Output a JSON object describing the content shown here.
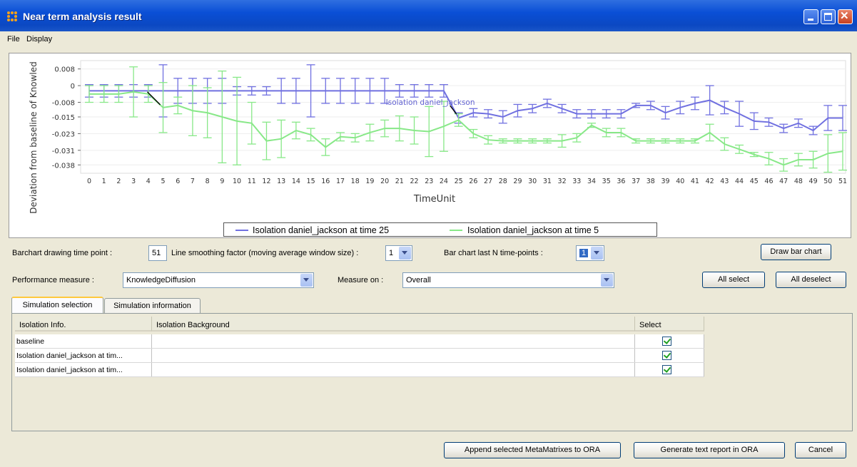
{
  "window": {
    "title": "Near term analysis result"
  },
  "menu": {
    "items": [
      "File",
      "Display"
    ]
  },
  "chart_data": {
    "type": "line",
    "xlabel": "TimeUnit",
    "ylabel": "Deviation from baseline of Knowled",
    "x": [
      0,
      1,
      2,
      3,
      4,
      5,
      6,
      7,
      8,
      9,
      10,
      11,
      12,
      13,
      14,
      15,
      16,
      17,
      18,
      19,
      20,
      21,
      22,
      23,
      24,
      25,
      26,
      27,
      28,
      29,
      30,
      31,
      32,
      33,
      34,
      35,
      36,
      37,
      38,
      39,
      40,
      41,
      42,
      43,
      44,
      45,
      46,
      47,
      48,
      49,
      50,
      51
    ],
    "x_tick_labels": [
      "0",
      "1",
      "2",
      "3",
      "4",
      "5",
      "6",
      "7",
      "8",
      "9",
      "10",
      "11",
      "12",
      "13",
      "14",
      "15",
      "16",
      "17",
      "18",
      "19",
      "20",
      "21",
      "22",
      "23",
      "24",
      "25",
      "26",
      "27",
      "28",
      "29",
      "30",
      "31",
      "32",
      "33",
      "34",
      "35",
      "36",
      "37",
      "38",
      "39",
      "40",
      "41",
      "42",
      "43",
      "44",
      "45",
      "46",
      "47",
      "48",
      "49",
      "50",
      "51"
    ],
    "y_tick_labels": [
      "0.008",
      "0",
      "-0.008",
      "-0.015",
      "-0.023",
      "-0.031",
      "-0.038"
    ],
    "ylim": [
      -0.042,
      0.012
    ],
    "grid": true,
    "legend_position": "bottom-center",
    "annotations": [
      {
        "text": "Isolation daniel_jackson",
        "x": 25,
        "y": -0.015
      }
    ],
    "series": [
      {
        "name": "Isolation daniel_jackson at time 25",
        "color": "#7070E0",
        "values": [
          -0.0025,
          -0.0025,
          -0.0025,
          -0.0025,
          -0.0025,
          -0.0025,
          -0.0025,
          -0.0025,
          -0.0025,
          -0.0025,
          -0.0025,
          -0.0025,
          -0.0025,
          -0.0025,
          -0.0025,
          -0.0025,
          -0.0025,
          -0.0025,
          -0.0025,
          -0.0025,
          -0.0025,
          -0.0025,
          -0.0025,
          -0.0025,
          -0.0025,
          -0.0155,
          -0.013,
          -0.0135,
          -0.015,
          -0.012,
          -0.011,
          -0.0085,
          -0.011,
          -0.0135,
          -0.0135,
          -0.0135,
          -0.0135,
          -0.0095,
          -0.0095,
          -0.013,
          -0.0105,
          -0.0085,
          -0.007,
          -0.0105,
          -0.0135,
          -0.017,
          -0.0175,
          -0.0205,
          -0.018,
          -0.0215,
          -0.0155,
          -0.0155
        ],
        "err": [
          0.003,
          0.003,
          0.003,
          0.003,
          0.003,
          0.0125,
          0.006,
          0.006,
          0.006,
          0.006,
          0.002,
          0.002,
          0.002,
          0.006,
          0.006,
          0.0125,
          0.006,
          0.006,
          0.006,
          0.006,
          0.006,
          0.003,
          0.003,
          0.003,
          0.003,
          0.0025,
          0.002,
          0.002,
          0.003,
          0.003,
          0.002,
          0.002,
          0.002,
          0.002,
          0.002,
          0.002,
          0.002,
          0.001,
          0.002,
          0.003,
          0.003,
          0.003,
          0.007,
          0.003,
          0.006,
          0.004,
          0.002,
          0.002,
          0.002,
          0.002,
          0.006,
          0.006
        ]
      },
      {
        "name": "Isolation daniel_jackson at time 5",
        "color": "#88E888",
        "values": [
          -0.004,
          -0.004,
          -0.004,
          -0.003,
          -0.004,
          -0.0105,
          -0.0095,
          -0.012,
          -0.013,
          -0.015,
          -0.017,
          -0.018,
          -0.0265,
          -0.0255,
          -0.0215,
          -0.0235,
          -0.0295,
          -0.0245,
          -0.025,
          -0.0225,
          -0.0205,
          -0.0205,
          -0.0215,
          -0.022,
          -0.0195,
          -0.0165,
          -0.023,
          -0.026,
          -0.0265,
          -0.0265,
          -0.0265,
          -0.0265,
          -0.0265,
          -0.025,
          -0.019,
          -0.0225,
          -0.0225,
          -0.0265,
          -0.0265,
          -0.0265,
          -0.0265,
          -0.0265,
          -0.0225,
          -0.028,
          -0.0305,
          -0.033,
          -0.035,
          -0.038,
          -0.0355,
          -0.0355,
          -0.0325,
          -0.0315
        ],
        "err": [
          0.004,
          0.004,
          0.004,
          0.012,
          0.004,
          0.012,
          0.004,
          0.012,
          0.012,
          0.022,
          0.021,
          0.01,
          0.009,
          0.009,
          0.004,
          0.003,
          0.004,
          0.002,
          0.002,
          0.004,
          0.004,
          0.006,
          0.0065,
          0.012,
          0.012,
          0.003,
          0.002,
          0.002,
          0.001,
          0.001,
          0.001,
          0.001,
          0.003,
          0.002,
          0.001,
          0.002,
          0.002,
          0.001,
          0.001,
          0.001,
          0.001,
          0.001,
          0.004,
          0.003,
          0.002,
          0.001,
          0.003,
          0.003,
          0.003,
          0.004,
          0.009,
          0.009
        ]
      }
    ]
  },
  "legend": {
    "items": [
      {
        "label": "Isolation daniel_jackson at time 25",
        "color": "#7070E0"
      },
      {
        "label": "Isolation daniel_jackson at time 5",
        "color": "#88E888"
      }
    ]
  },
  "controls": {
    "barchart_time_label": "Barchart drawing time point :",
    "barchart_time_value": "51",
    "smoothing_label": "Line smoothing factor (moving average window size) :",
    "smoothing_value": "1",
    "lastn_label": "Bar chart last N time-points :",
    "lastn_value": "1",
    "draw_bar_chart": "Draw bar chart",
    "performance_label": "Performance measure :",
    "performance_value": "KnowledgeDiffusion",
    "measure_on_label": "Measure on :",
    "measure_on_value": "Overall",
    "all_select": "All select",
    "all_deselect": "All deselect"
  },
  "tabs": [
    "Simulation selection",
    "Simulation information"
  ],
  "table": {
    "headers": [
      "Isolation Info.",
      "Isolation Background",
      "Select"
    ],
    "rows": [
      {
        "info": "baseline",
        "background": "",
        "selected": true
      },
      {
        "info": "Isolation daniel_jackson at tim...",
        "background": "",
        "selected": true
      },
      {
        "info": "Isolation daniel_jackson at tim...",
        "background": "",
        "selected": true
      }
    ]
  },
  "footer": {
    "append": "Append selected MetaMatrixes to ORA",
    "generate": "Generate text report in ORA",
    "cancel": "Cancel"
  }
}
